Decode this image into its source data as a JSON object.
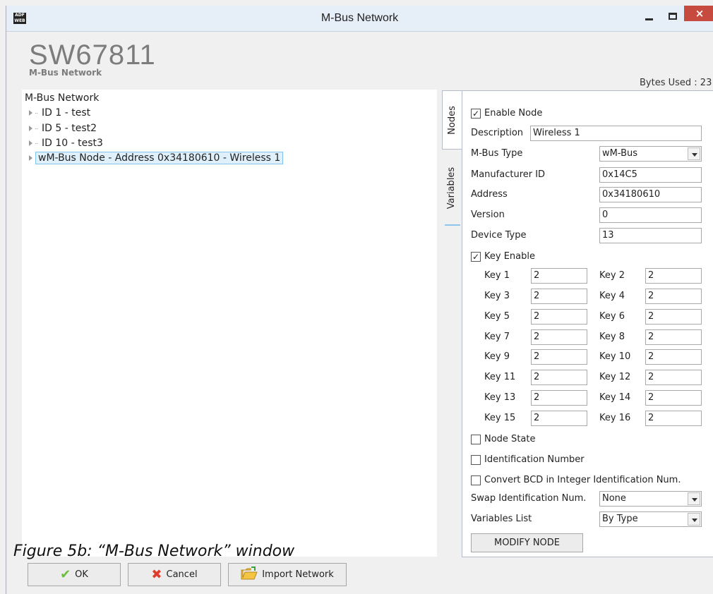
{
  "window": {
    "title": "M-Bus Network",
    "close_glyph": "×"
  },
  "header": {
    "brand": "SW67811",
    "subtitle": "M-Bus Network",
    "bytes_used": "Bytes Used : 23"
  },
  "tree": {
    "root": "M-Bus Network",
    "items": [
      {
        "label": "ID 1 - test",
        "selected": false
      },
      {
        "label": "ID 5 - test2",
        "selected": false
      },
      {
        "label": "ID 10 - test3",
        "selected": false
      },
      {
        "label": "wM-Bus Node - Address 0x34180610 - Wireless 1",
        "selected": true
      }
    ]
  },
  "tabs": {
    "nodes": "Nodes",
    "variables": "Variables"
  },
  "form": {
    "enable_node": {
      "label": "Enable Node",
      "checked": true
    },
    "description": {
      "label": "Description",
      "value": "Wireless 1"
    },
    "mbus_type": {
      "label": "M-Bus Type",
      "value": "wM-Bus"
    },
    "manufacturer_id": {
      "label": "Manufacturer ID",
      "value": "0x14C5"
    },
    "address": {
      "label": "Address",
      "value": "0x34180610"
    },
    "version": {
      "label": "Version",
      "value": "0"
    },
    "device_type": {
      "label": "Device Type",
      "value": "13"
    },
    "key_enable": {
      "label": "Key Enable",
      "checked": true
    },
    "keys": [
      {
        "label": "Key 1",
        "value": "2"
      },
      {
        "label": "Key 2",
        "value": "2"
      },
      {
        "label": "Key 3",
        "value": "2"
      },
      {
        "label": "Key 4",
        "value": "2"
      },
      {
        "label": "Key 5",
        "value": "2"
      },
      {
        "label": "Key 6",
        "value": "2"
      },
      {
        "label": "Key 7",
        "value": "2"
      },
      {
        "label": "Key 8",
        "value": "2"
      },
      {
        "label": "Key 9",
        "value": "2"
      },
      {
        "label": "Key 10",
        "value": "2"
      },
      {
        "label": "Key 11",
        "value": "2"
      },
      {
        "label": "Key 12",
        "value": "2"
      },
      {
        "label": "Key 13",
        "value": "2"
      },
      {
        "label": "Key 14",
        "value": "2"
      },
      {
        "label": "Key 15",
        "value": "2"
      },
      {
        "label": "Key 16",
        "value": "2"
      }
    ],
    "node_state": {
      "label": "Node State",
      "checked": false
    },
    "identification_number": {
      "label": "Identification Number",
      "checked": false
    },
    "convert_bcd": {
      "label": "Convert BCD in Integer Identification Num.",
      "checked": false
    },
    "swap_id": {
      "label": "Swap Identification Num.",
      "value": "None"
    },
    "variables_list": {
      "label": "Variables List",
      "value": "By Type"
    },
    "modify_button": "MODIFY NODE"
  },
  "caption": "Figure 5b: “M-Bus Network” window",
  "buttons": {
    "ok": "OK",
    "cancel": "Cancel",
    "import": "Import Network"
  },
  "icons": {
    "ok": "check-icon",
    "cancel": "x-icon",
    "import": "folder-icon"
  },
  "colors": {
    "close_button": "#c74a3e",
    "selection_border": "#82c3ea",
    "ok_check": "#6cbf3a",
    "cancel_x": "#e03a2c"
  }
}
